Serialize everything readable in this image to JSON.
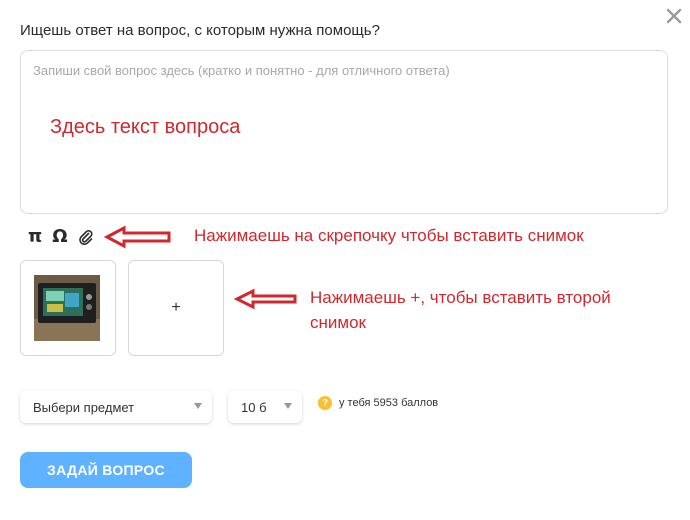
{
  "dialog": {
    "title": "Ищешь ответ на вопрос, с которым нужна помощь?",
    "close_icon": "close-icon"
  },
  "question": {
    "placeholder": "Запиши свой вопрос здесь (кратко и понятно - для отличного ответа)",
    "value": ""
  },
  "toolbar": {
    "pi": "π",
    "omega": "Ω",
    "attach_icon": "paperclip-icon"
  },
  "attachments": {
    "add_label": "+"
  },
  "annotations": {
    "question_text": "Здесь текст вопроса",
    "clip_hint": "Нажимаешь на скрепочку чтобы вставить снимок",
    "plus_hint": "Нажимаешь +, чтобы вставить второй снимок",
    "color": "#d0282d"
  },
  "form": {
    "subject_select": "Выбери предмет",
    "points_select": "10 б",
    "balance_icon": "?",
    "balance_text": "у тебя 5953 баллов"
  },
  "submit": {
    "label": "ЗАДАЙ ВОПРОС",
    "color": "#5fb2ff"
  }
}
